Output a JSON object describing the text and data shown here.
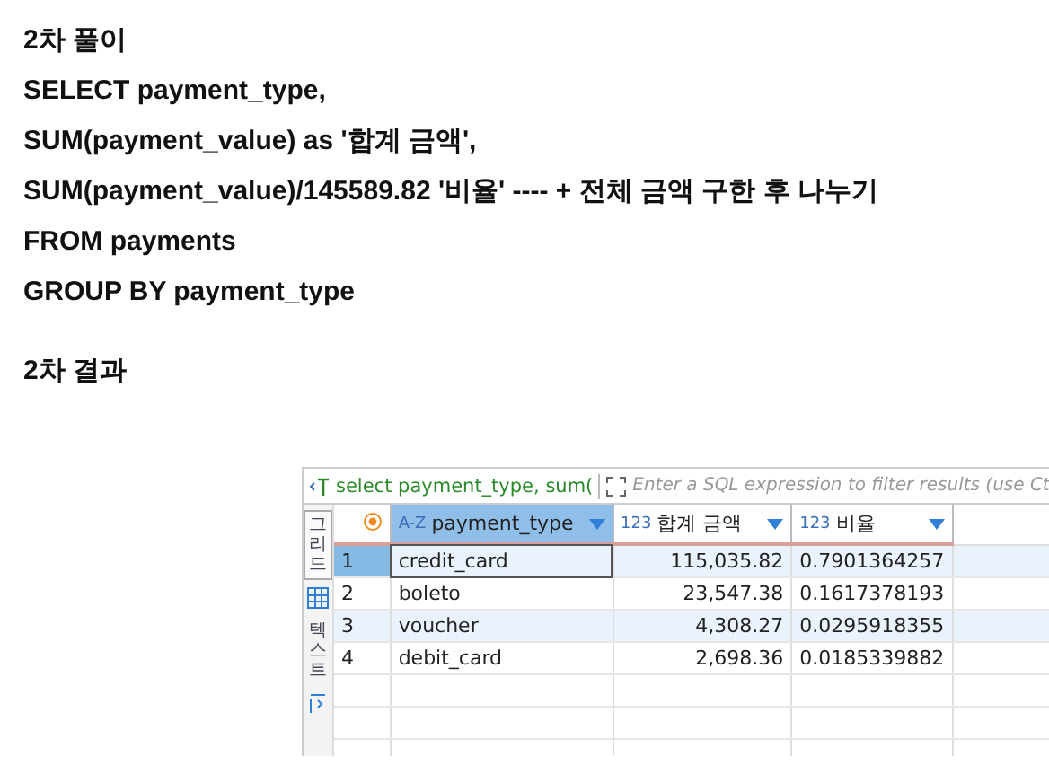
{
  "post": {
    "heading": "2차 풀이",
    "code_lines": [
      "SELECT payment_type,",
      "SUM(payment_value) as '합계 금액',",
      "SUM(payment_value)/145589.82 '비율' ---- + 전체 금액 구한 후 나누기",
      "FROM payments",
      "GROUP BY payment_type"
    ],
    "result_heading": "2차 결과"
  },
  "result_panel": {
    "query_preview": "select payment_type, sum(",
    "filter_placeholder": "Enter a SQL expression to filter results (use Ct",
    "side_tabs": [
      {
        "label": "그리드",
        "selected": true
      },
      {
        "label": "텍스트",
        "selected": false
      }
    ],
    "columns": [
      {
        "type_badge": "A-Z",
        "label": "payment_type",
        "selected": true
      },
      {
        "type_badge": "123",
        "label": "합계 금액",
        "selected": false
      },
      {
        "type_badge": "123",
        "label": "비율",
        "selected": false
      }
    ],
    "rows": [
      {
        "number": "1",
        "selected": true,
        "cells": [
          "credit_card",
          "115,035.82",
          "0.7901364257"
        ]
      },
      {
        "number": "2",
        "selected": false,
        "cells": [
          "boleto",
          "23,547.38",
          "0.1617378193"
        ]
      },
      {
        "number": "3",
        "selected": false,
        "cells": [
          "voucher",
          "4,308.27",
          "0.0295918355"
        ]
      },
      {
        "number": "4",
        "selected": false,
        "cells": [
          "debit_card",
          "2,698.36",
          "0.0185339882"
        ]
      }
    ]
  }
}
